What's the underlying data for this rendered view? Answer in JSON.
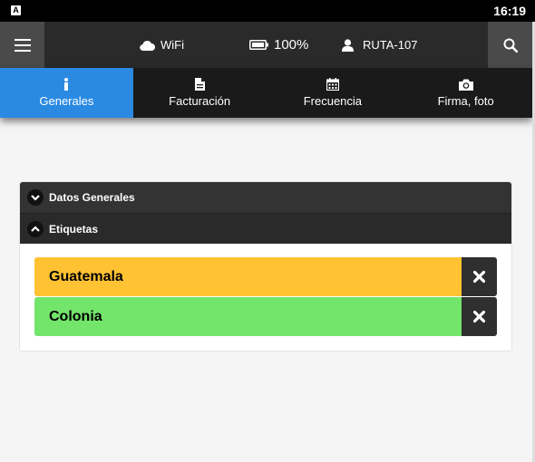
{
  "status_bar": {
    "app_icon": "A",
    "time": "16:19"
  },
  "topbar": {
    "wifi_label": "WiFi",
    "battery_label": "100%",
    "route_label": "RUTA-107"
  },
  "tabs": [
    {
      "label": "Generales",
      "icon": "info-icon",
      "active": true
    },
    {
      "label": "Facturación",
      "icon": "document-icon",
      "active": false
    },
    {
      "label": "Frecuencia",
      "icon": "calendar-icon",
      "active": false
    },
    {
      "label": "Firma, foto",
      "icon": "camera-icon",
      "active": false
    }
  ],
  "accordion": {
    "sections": [
      {
        "title": "Datos Generales",
        "expanded": false
      },
      {
        "title": "Etiquetas",
        "expanded": true
      }
    ]
  },
  "tags": [
    {
      "label": "Guatemala",
      "color": "#ffc232"
    },
    {
      "label": "Colonia",
      "color": "#72e56a"
    }
  ],
  "colors": {
    "accent": "#2a8ae2",
    "dark": "#2a2a2a"
  }
}
